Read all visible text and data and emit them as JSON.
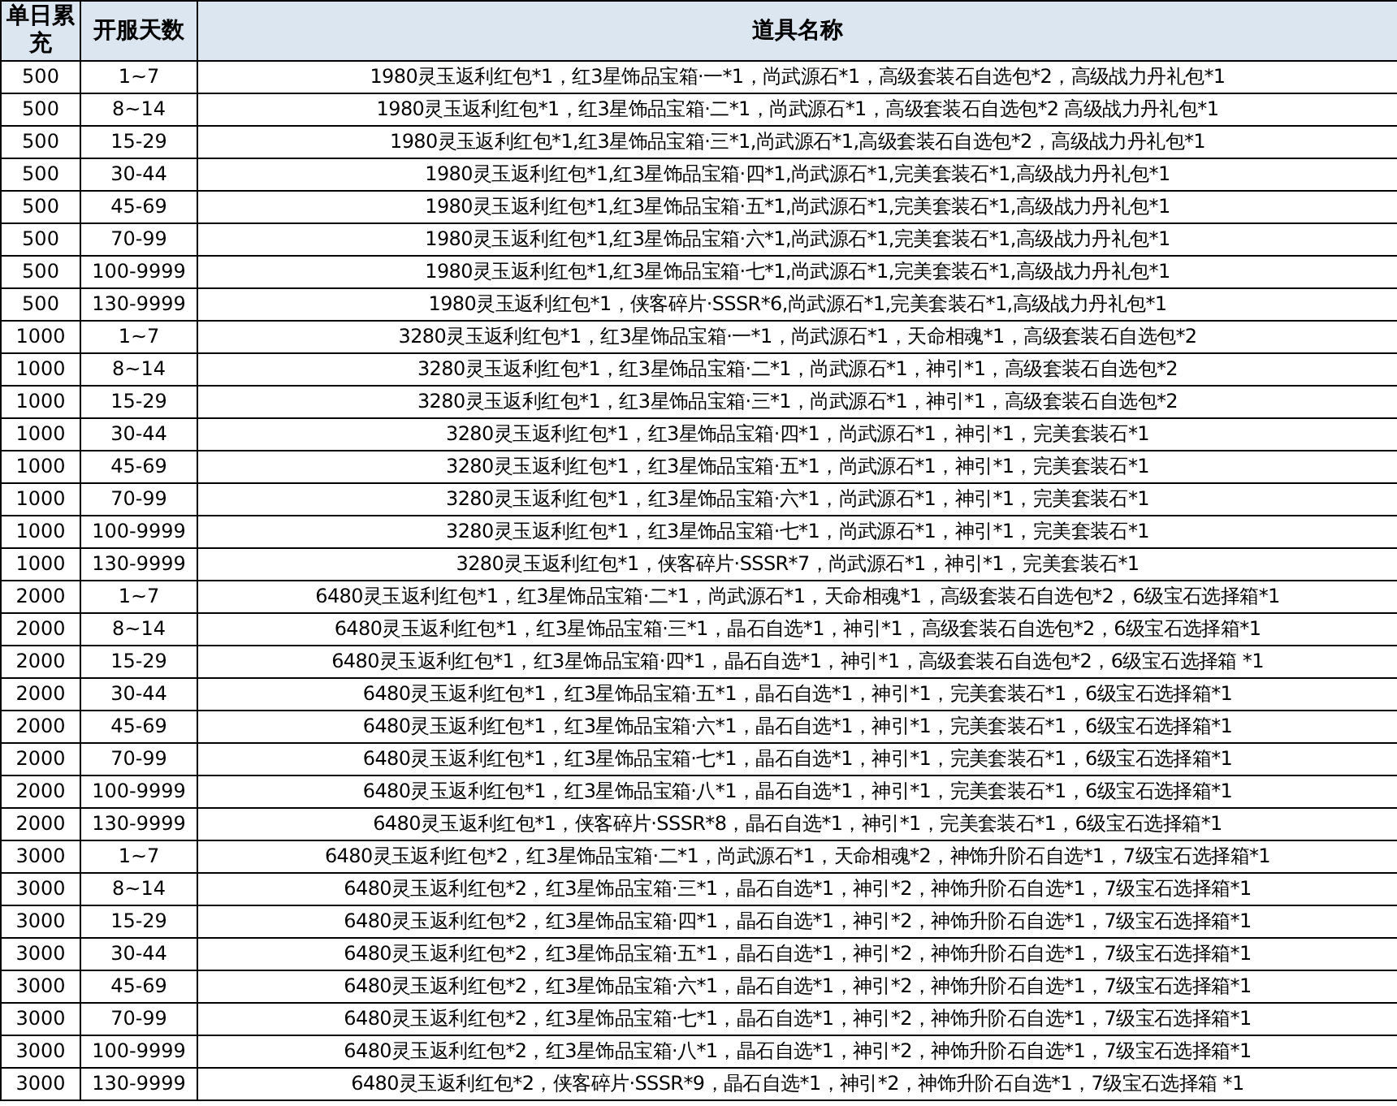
{
  "table": {
    "columns": [
      "单日累充",
      "开服天数",
      "道具名称"
    ],
    "rows": [
      [
        "500",
        "1~7",
        "1980灵玉返利红包*1，红3星饰品宝箱·一*1，尚武源石*1，高级套装石自选包*2，高级战力丹礼包*1"
      ],
      [
        "500",
        "8~14",
        "1980灵玉返利红包*1，红3星饰品宝箱·二*1，尚武源石*1，高级套装石自选包*2 高级战力丹礼包*1"
      ],
      [
        "500",
        "15-29",
        "1980灵玉返利红包*1,红3星饰品宝箱·三*1,尚武源石*1,高级套装石自选包*2，高级战力丹礼包*1"
      ],
      [
        "500",
        "30-44",
        "1980灵玉返利红包*1,红3星饰品宝箱·四*1,尚武源石*1,完美套装石*1,高级战力丹礼包*1"
      ],
      [
        "500",
        "45-69",
        "1980灵玉返利红包*1,红3星饰品宝箱·五*1,尚武源石*1,完美套装石*1,高级战力丹礼包*1"
      ],
      [
        "500",
        "70-99",
        "1980灵玉返利红包*1,红3星饰品宝箱·六*1,尚武源石*1,完美套装石*1,高级战力丹礼包*1"
      ],
      [
        "500",
        "100-9999",
        "1980灵玉返利红包*1,红3星饰品宝箱·七*1,尚武源石*1,完美套装石*1,高级战力丹礼包*1"
      ],
      [
        "500",
        "130-9999",
        "1980灵玉返利红包*1，侠客碎片·SSSR*6,尚武源石*1,完美套装石*1,高级战力丹礼包*1"
      ],
      [
        "1000",
        "1~7",
        "3280灵玉返利红包*1，红3星饰品宝箱·一*1，尚武源石*1，天命相魂*1，高级套装石自选包*2"
      ],
      [
        "1000",
        "8~14",
        "3280灵玉返利红包*1，红3星饰品宝箱·二*1，尚武源石*1，神引*1，高级套装石自选包*2"
      ],
      [
        "1000",
        "15-29",
        "3280灵玉返利红包*1，红3星饰品宝箱·三*1，尚武源石*1，神引*1，高级套装石自选包*2"
      ],
      [
        "1000",
        "30-44",
        "3280灵玉返利红包*1，红3星饰品宝箱·四*1，尚武源石*1，神引*1，完美套装石*1"
      ],
      [
        "1000",
        "45-69",
        "3280灵玉返利红包*1，红3星饰品宝箱·五*1，尚武源石*1，神引*1，完美套装石*1"
      ],
      [
        "1000",
        "70-99",
        "3280灵玉返利红包*1，红3星饰品宝箱·六*1，尚武源石*1，神引*1，完美套装石*1"
      ],
      [
        "1000",
        "100-9999",
        "3280灵玉返利红包*1，红3星饰品宝箱·七*1，尚武源石*1，神引*1，完美套装石*1"
      ],
      [
        "1000",
        "130-9999",
        "3280灵玉返利红包*1，侠客碎片·SSSR*7，尚武源石*1，神引*1，完美套装石*1"
      ],
      [
        "2000",
        "1~7",
        "6480灵玉返利红包*1，红3星饰品宝箱·二*1，尚武源石*1，天命相魂*1，高级套装石自选包*2，6级宝石选择箱*1"
      ],
      [
        "2000",
        "8~14",
        "6480灵玉返利红包*1，红3星饰品宝箱·三*1，晶石自选*1，神引*1，高级套装石自选包*2，6级宝石选择箱*1"
      ],
      [
        "2000",
        "15-29",
        "6480灵玉返利红包*1，红3星饰品宝箱·四*1，晶石自选*1，神引*1，高级套装石自选包*2，6级宝石选择箱 *1"
      ],
      [
        "2000",
        "30-44",
        "6480灵玉返利红包*1，红3星饰品宝箱·五*1，晶石自选*1，神引*1，完美套装石*1，6级宝石选择箱*1"
      ],
      [
        "2000",
        "45-69",
        "6480灵玉返利红包*1，红3星饰品宝箱·六*1，晶石自选*1，神引*1，完美套装石*1，6级宝石选择箱*1"
      ],
      [
        "2000",
        "70-99",
        "6480灵玉返利红包*1，红3星饰品宝箱·七*1，晶石自选*1，神引*1，完美套装石*1，6级宝石选择箱*1"
      ],
      [
        "2000",
        "100-9999",
        "6480灵玉返利红包*1，红3星饰品宝箱·八*1，晶石自选*1，神引*1，完美套装石*1，6级宝石选择箱*1"
      ],
      [
        "2000",
        "130-9999",
        "6480灵玉返利红包*1，侠客碎片·SSSR*8，晶石自选*1，神引*1，完美套装石*1，6级宝石选择箱*1"
      ],
      [
        "3000",
        "1~7",
        "6480灵玉返利红包*2，红3星饰品宝箱·二*1，尚武源石*1，天命相魂*2，神饰升阶石自选*1，7级宝石选择箱*1"
      ],
      [
        "3000",
        "8~14",
        "6480灵玉返利红包*2，红3星饰品宝箱·三*1，晶石自选*1，神引*2，神饰升阶石自选*1，7级宝石选择箱*1"
      ],
      [
        "3000",
        "15-29",
        "6480灵玉返利红包*2，红3星饰品宝箱·四*1，晶石自选*1，神引*2，神饰升阶石自选*1，7级宝石选择箱*1"
      ],
      [
        "3000",
        "30-44",
        "6480灵玉返利红包*2，红3星饰品宝箱·五*1，晶石自选*1，神引*2，神饰升阶石自选*1，7级宝石选择箱*1"
      ],
      [
        "3000",
        "45-69",
        "6480灵玉返利红包*2，红3星饰品宝箱·六*1，晶石自选*1，神引*2，神饰升阶石自选*1，7级宝石选择箱*1"
      ],
      [
        "3000",
        "70-99",
        "6480灵玉返利红包*2，红3星饰品宝箱·七*1，晶石自选*1，神引*2，神饰升阶石自选*1，7级宝石选择箱*1"
      ],
      [
        "3000",
        "100-9999",
        "6480灵玉返利红包*2，红3星饰品宝箱·八*1，晶石自选*1，神引*2，神饰升阶石自选*1，7级宝石选择箱*1"
      ],
      [
        "3000",
        "130-9999",
        "6480灵玉返利红包*2，侠客碎片·SSSR*9，晶石自选*1，神引*2，神饰升阶石自选*1，7级宝石选择箱 *1"
      ]
    ]
  }
}
